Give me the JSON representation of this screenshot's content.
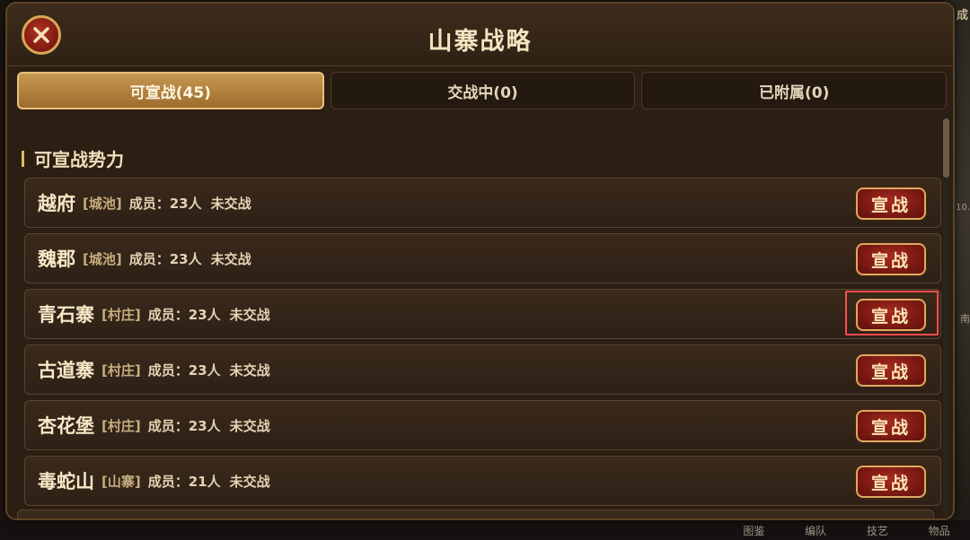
{
  "dialog": {
    "title": "山寨战略"
  },
  "tabs": [
    {
      "label": "可宣战(45)",
      "active": true
    },
    {
      "label": "交战中(0)",
      "active": false
    },
    {
      "label": "已附属(0)",
      "active": false
    }
  ],
  "section": {
    "title": "可宣战势力"
  },
  "rows": [
    {
      "name": "越府",
      "type": "[城池]",
      "members": "成员：23人",
      "status": "未交战",
      "button": "宣战"
    },
    {
      "name": "魏郡",
      "type": "[城池]",
      "members": "成员：23人",
      "status": "未交战",
      "button": "宣战"
    },
    {
      "name": "青石寨",
      "type": "[村庄]",
      "members": "成员：23人",
      "status": "未交战",
      "button": "宣战"
    },
    {
      "name": "古道寨",
      "type": "[村庄]",
      "members": "成员：23人",
      "status": "未交战",
      "button": "宣战"
    },
    {
      "name": "杏花堡",
      "type": "[村庄]",
      "members": "成员：23人",
      "status": "未交战",
      "button": "宣战"
    },
    {
      "name": "毒蛇山",
      "type": "[山寨]",
      "members": "成员：21人",
      "status": "未交战",
      "button": "宣战"
    }
  ],
  "bottom_nav": [
    "图鉴",
    "编队",
    "技艺",
    "物品"
  ],
  "side_hints": [
    "成",
    "10.",
    "南"
  ],
  "colors": {
    "accent_gold": "#e7b763",
    "button_red": "#a72a22",
    "highlight": "#ff4c4c"
  }
}
